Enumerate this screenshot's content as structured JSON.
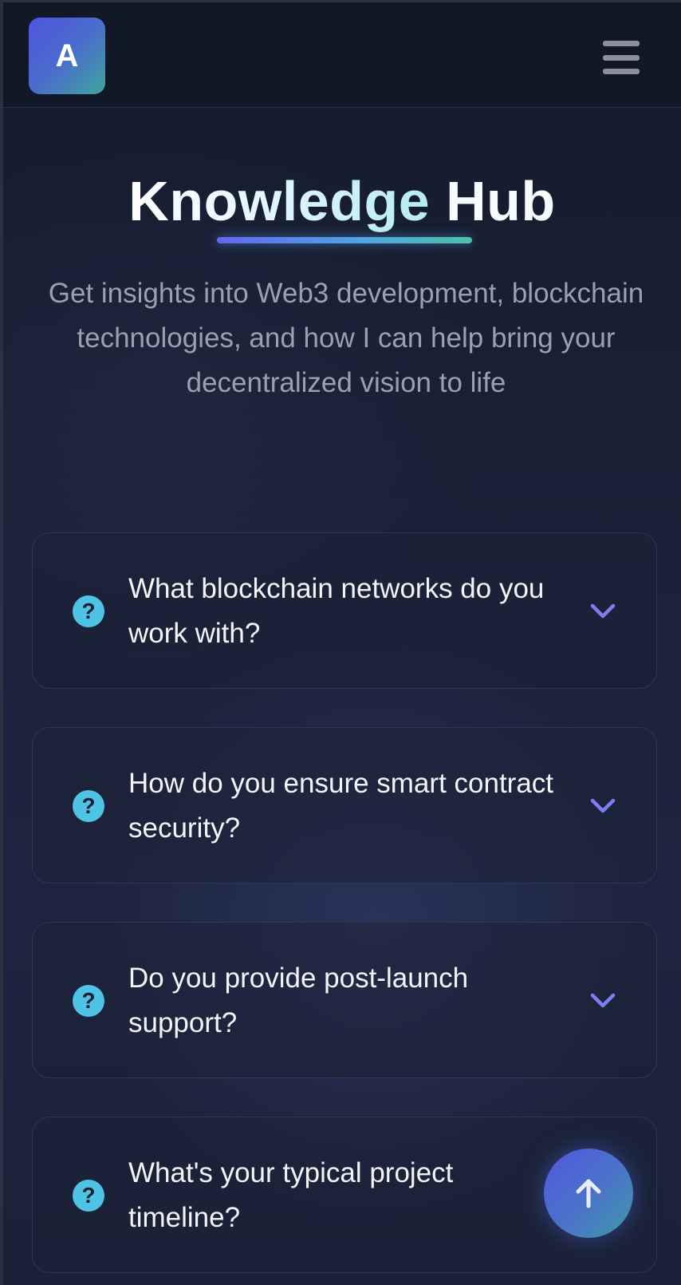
{
  "header": {
    "logo_letter": "A",
    "menu_icon": "hamburger-menu-icon"
  },
  "hero": {
    "title_part1": "Knowledge",
    "title_part2": "Hub",
    "subtitle": "Get insights into Web3 development, blockchain technologies, and how I can help bring your decentralized vision to life"
  },
  "faq": {
    "items": [
      {
        "question": "What blockchain networks do you work with?"
      },
      {
        "question": "How do you ensure smart contract security?"
      },
      {
        "question": "Do you provide post-launch support?"
      },
      {
        "question": "What's your typical project timeline?"
      }
    ],
    "question_icon": "question-circle-icon",
    "toggle_icon": "chevron-down-icon"
  },
  "scroll_top": {
    "icon": "arrow-up-icon"
  },
  "colors": {
    "accent_indigo": "#6366f1",
    "accent_cyan": "#4fc3e6",
    "accent_teal": "#4cc3a6",
    "background": "#141a2b"
  }
}
